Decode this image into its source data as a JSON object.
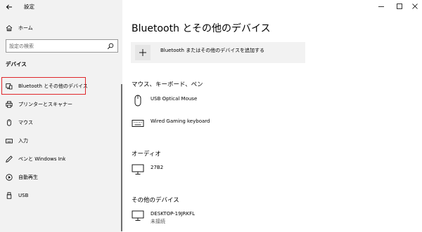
{
  "window": {
    "title": "設定"
  },
  "sidebar": {
    "home_label": "ホーム",
    "search_placeholder": "設定の検索",
    "section_title": "デバイス",
    "items": [
      {
        "label": "Bluetooth とその他のデバイス",
        "icon": "bluetooth-devices-icon",
        "selected": true
      },
      {
        "label": "プリンターとスキャナー",
        "icon": "printer-icon"
      },
      {
        "label": "マウス",
        "icon": "mouse-icon"
      },
      {
        "label": "入力",
        "icon": "keyboard-icon"
      },
      {
        "label": "ペンと Windows Ink",
        "icon": "pen-icon"
      },
      {
        "label": "自動再生",
        "icon": "autoplay-icon"
      },
      {
        "label": "USB",
        "icon": "usb-icon"
      }
    ]
  },
  "main": {
    "title": "Bluetooth とその他のデバイス",
    "add_device_label": "Bluetooth またはその他のデバイスを追加する",
    "groups": [
      {
        "title": "マウス、キーボード、ペン",
        "devices": [
          {
            "name": "USB Optical Mouse",
            "icon": "mouse-icon"
          },
          {
            "name": "Wired Gaming keyboard",
            "icon": "keyboard-icon"
          }
        ]
      },
      {
        "title": "オーディオ",
        "devices": [
          {
            "name": "27B2",
            "icon": "monitor-icon"
          }
        ]
      },
      {
        "title": "その他のデバイス",
        "devices": [
          {
            "name": "DESKTOP-19JRKFL",
            "status": "未接続",
            "icon": "computer-icon"
          }
        ]
      }
    ]
  },
  "colors": {
    "selection_outline": "#e0262a",
    "sidebar_bg": "#f2f2f2"
  }
}
